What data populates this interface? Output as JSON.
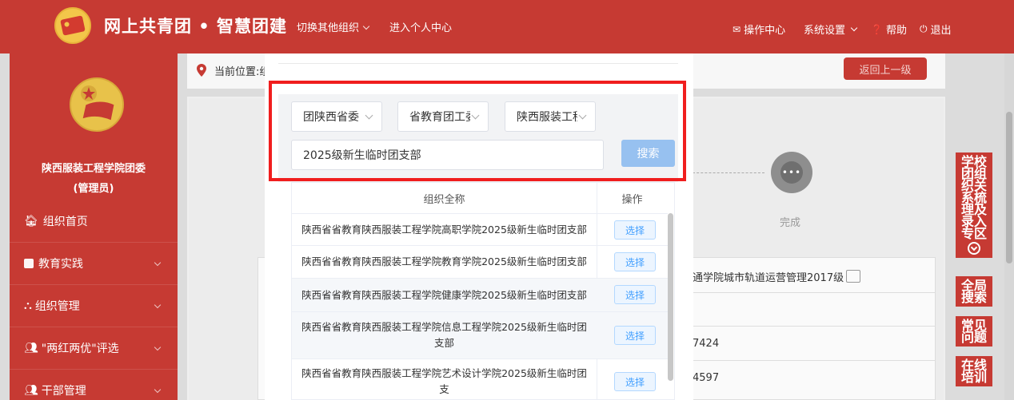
{
  "header": {
    "title": "网上共青团 • 智慧团建",
    "nav": [
      {
        "label": "切换其他组织",
        "has_dropdown": true
      },
      {
        "label": "进入个人中心",
        "has_dropdown": false
      }
    ],
    "right": [
      {
        "label": "操作中心",
        "icon": "mail-icon"
      },
      {
        "label": "系统设置",
        "icon": "",
        "has_dropdown": true
      },
      {
        "label": "帮助",
        "icon": "help-icon"
      },
      {
        "label": "退出",
        "icon": "power-icon"
      }
    ]
  },
  "sidebar": {
    "org_name": "陕西服装工程学院团委",
    "role": "(管理员)",
    "items": [
      {
        "label": "组织首页",
        "icon": "home-icon"
      },
      {
        "label": "教育实践",
        "icon": "edit-icon",
        "expandable": true
      },
      {
        "label": "组织管理",
        "icon": "sitemap-icon",
        "expandable": true
      },
      {
        "label": "\"两红两优\"评选",
        "icon": "group-icon",
        "expandable": true
      },
      {
        "label": "干部管理",
        "icon": "group-icon",
        "expandable": true
      }
    ]
  },
  "main": {
    "location_label": "当前位置:组",
    "back_button": "返回上一级",
    "step_label": "完成",
    "step_icon": "•••",
    "table_texts": [
      "通学院城市轨道运营管理2017级",
      "7424",
      "4597"
    ]
  },
  "right_float": [
    {
      "label": "学校团组织关系梳理及录入专区",
      "lines": [
        "学校",
        "团组",
        "织关",
        "系梳",
        "理及",
        "录入",
        "专区"
      ]
    },
    {
      "label": "全局搜索",
      "lines": [
        "全局",
        "搜索"
      ]
    },
    {
      "label": "常见问题",
      "lines": [
        "常见",
        "问题"
      ]
    },
    {
      "label": "在线培训",
      "lines": [
        "在线",
        "培训"
      ]
    }
  ],
  "modal": {
    "selects": [
      "团陕西省委",
      "省教育团工委",
      "陕西服装工程"
    ],
    "search_value": "2025级新生临时团支部",
    "search_button": "搜索",
    "columns": [
      "组织全称",
      "操作"
    ],
    "rows": [
      {
        "name": "陕西省省教育陕西服装工程学院高职学院2025级新生临时团支部",
        "action": "选择"
      },
      {
        "name": "陕西省省教育陕西服装工程学院教育学院2025级新生临时团支部",
        "action": "选择"
      },
      {
        "name": "陕西省省教育陕西服装工程学院健康学院2025级新生临时团支部",
        "action": "选择"
      },
      {
        "name": "陕西省省教育陕西服装工程学院信息工程学院2025级新生临时团支部",
        "action": "选择"
      },
      {
        "name": "陕西省省教育陕西服装工程学院艺术设计学院2025级新生临时团支",
        "action": "选择"
      }
    ]
  },
  "colors": {
    "brand_red": "#c63a33",
    "highlight_red": "#f01e1e",
    "search_button": "#97c1f0",
    "select_button_text": "#409eff"
  }
}
